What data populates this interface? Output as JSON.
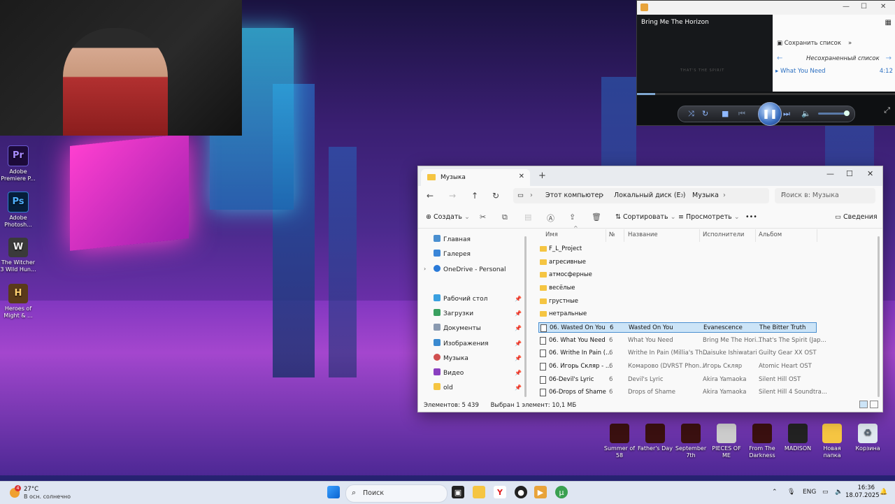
{
  "player": {
    "now_playing": "Bring Me The Horizon",
    "album_text": "THAT'S THE SPIRIT",
    "save_list": "Сохранить список",
    "unsaved_list": "Несохраненный список",
    "track": "What You Need",
    "duration": "4:12",
    "progress": 0.07
  },
  "desktop_icons": [
    {
      "label": "Adobe Premiere P...",
      "icon": "Pr"
    },
    {
      "label": "Adobe Photosh...",
      "icon": "Ps"
    },
    {
      "label": "The Witcher 3 Wild Hun...",
      "icon": "W"
    },
    {
      "label": "Heroes of Might & ...",
      "icon": "H"
    }
  ],
  "desktop_icons_right": [
    {
      "label": "Summer of 58"
    },
    {
      "label": "Father's Day"
    },
    {
      "label": "September 7th"
    },
    {
      "label": "PIECES OF ME"
    },
    {
      "label": "From The Darkness"
    },
    {
      "label": "MADISON"
    },
    {
      "label": "Новая папка"
    },
    {
      "label": "Корзина"
    }
  ],
  "explorer": {
    "tab_title": "Музыка",
    "breadcrumb": [
      "Этот компьютер",
      "Локальный диск (E:)",
      "Музыка"
    ],
    "search_placeholder": "Поиск в: Музыка",
    "toolbar": {
      "create": "Создать",
      "sort": "Сортировать",
      "view": "Просмотреть",
      "more": "•••",
      "details": "Сведения"
    },
    "sidebar": [
      {
        "label": "Главная"
      },
      {
        "label": "Галерея"
      },
      {
        "label": "OneDrive - Personal"
      },
      {
        "label": "Рабочий стол"
      },
      {
        "label": "Загрузки"
      },
      {
        "label": "Документы"
      },
      {
        "label": "Изображения"
      },
      {
        "label": "Музыка"
      },
      {
        "label": "Видео"
      },
      {
        "label": "old"
      }
    ],
    "columns": {
      "name": "Имя",
      "num": "№",
      "title": "Название",
      "artists": "Исполнители",
      "album": "Альбом"
    },
    "folders": [
      "F_L_Project",
      "агресивные",
      "атмосферные",
      "весёлые",
      "грустные",
      "нетральные"
    ],
    "files": [
      {
        "name": "06. Wasted On You",
        "num": "6",
        "title": "Wasted On You",
        "artist": "Evanescence",
        "album": "The Bitter Truth"
      },
      {
        "name": "06. What You Need",
        "num": "6",
        "title": "What You Need",
        "artist": "Bring Me The Hori...",
        "album": "That's The Spirit (Jap..."
      },
      {
        "name": "06. Writhe In Pain (...",
        "num": "6",
        "title": "Writhe In Pain (Millia's Th...",
        "artist": "Daisuke Ishiwatari",
        "album": "Guilty Gear XX OST"
      },
      {
        "name": "06. Игорь Скляр - ...",
        "num": "6",
        "title": "Комарово  (DVRST Phon...",
        "artist": "Игорь Скляр",
        "album": "Atomic Heart OST"
      },
      {
        "name": "06-Devil's Lyric",
        "num": "6",
        "title": "Devil's Lyric",
        "artist": "Akira Yamaoka",
        "album": "Silent Hill OST"
      },
      {
        "name": "06-Drops of Shame",
        "num": "6",
        "title": "Drops of Shame",
        "artist": "Akira Yamaoka",
        "album": "Silent Hill 4 Soundtra..."
      }
    ],
    "status_count": "Элементов: 5 439",
    "status_selected": "Выбран 1 элемент: 10,1 МБ"
  },
  "taskbar": {
    "weather_temp": "27°C",
    "weather_cond": "В осн. солнечно",
    "weather_badge": "4",
    "search_label": "Поиск",
    "lang": "ENG",
    "time": "16:36",
    "date": "18.07.2025"
  }
}
